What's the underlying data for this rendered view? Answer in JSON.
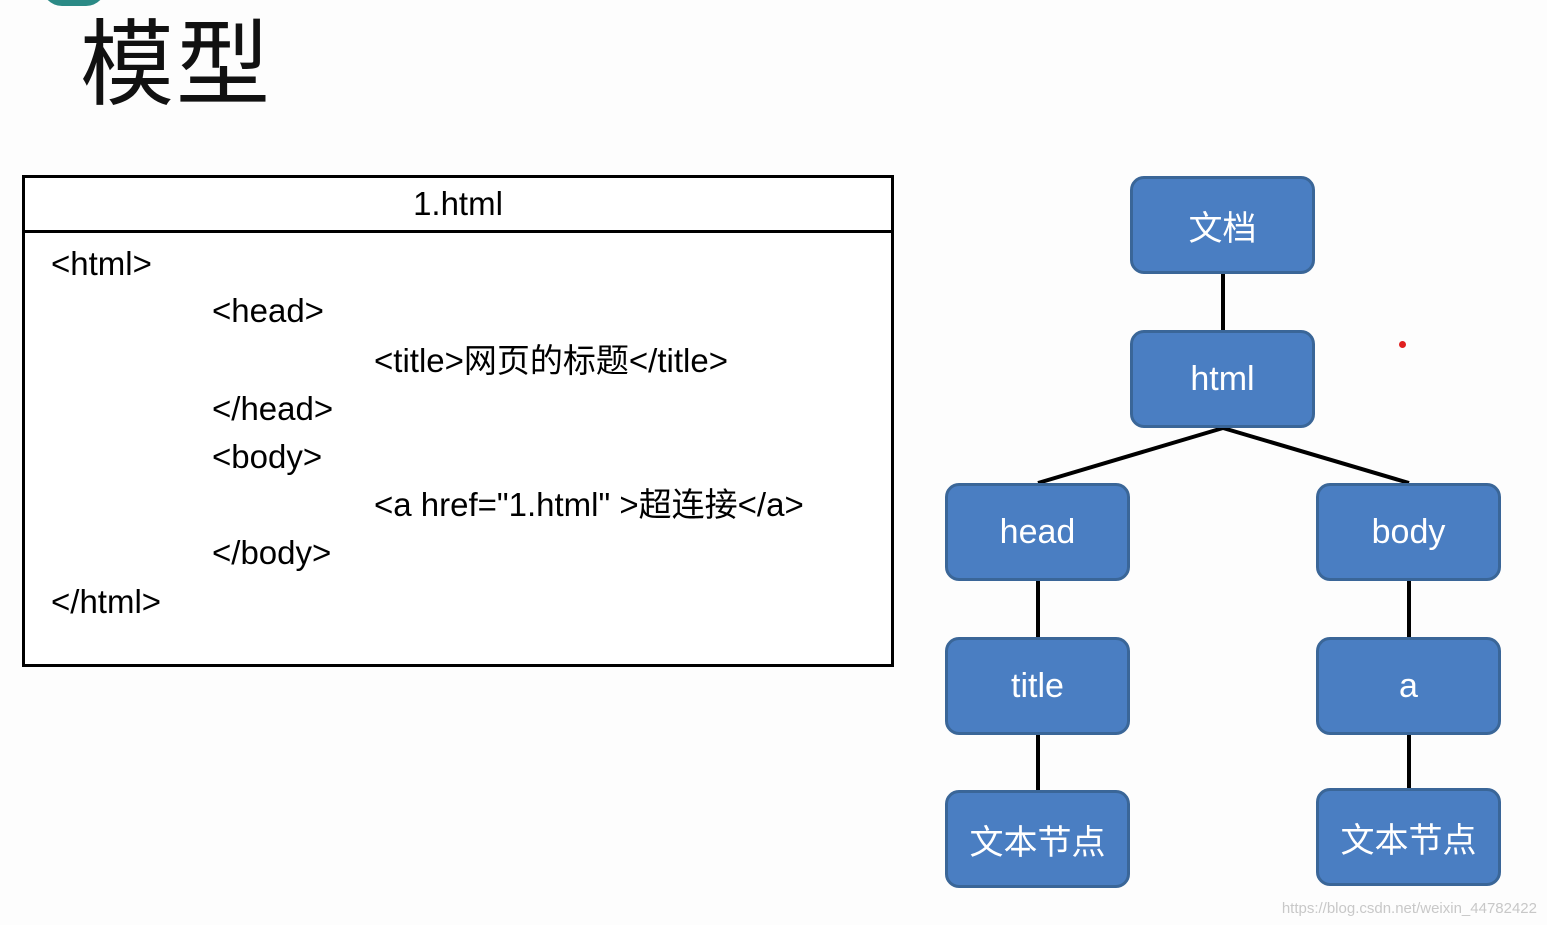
{
  "slide": {
    "title": "模型"
  },
  "code_panel": {
    "filename": "1.html",
    "lines": [
      "<html>",
      "<head>",
      "<title>网页的标题</title>",
      "</head>",
      "<body>",
      "<a href=\"1.html\" >超连接</a>",
      "</body>",
      "</html>"
    ]
  },
  "dom_tree": {
    "nodes": {
      "document": "文档",
      "html": "html",
      "head": "head",
      "body": "body",
      "title": "title",
      "a": "a",
      "text_left": "文本节点",
      "text_right": "文本节点"
    }
  },
  "colors": {
    "node_fill": "#4a7ec2",
    "node_border": "#3a6698",
    "connector": "#000000",
    "accent_dot": "#e02020"
  },
  "watermark": "https://blog.csdn.net/weixin_44782422"
}
